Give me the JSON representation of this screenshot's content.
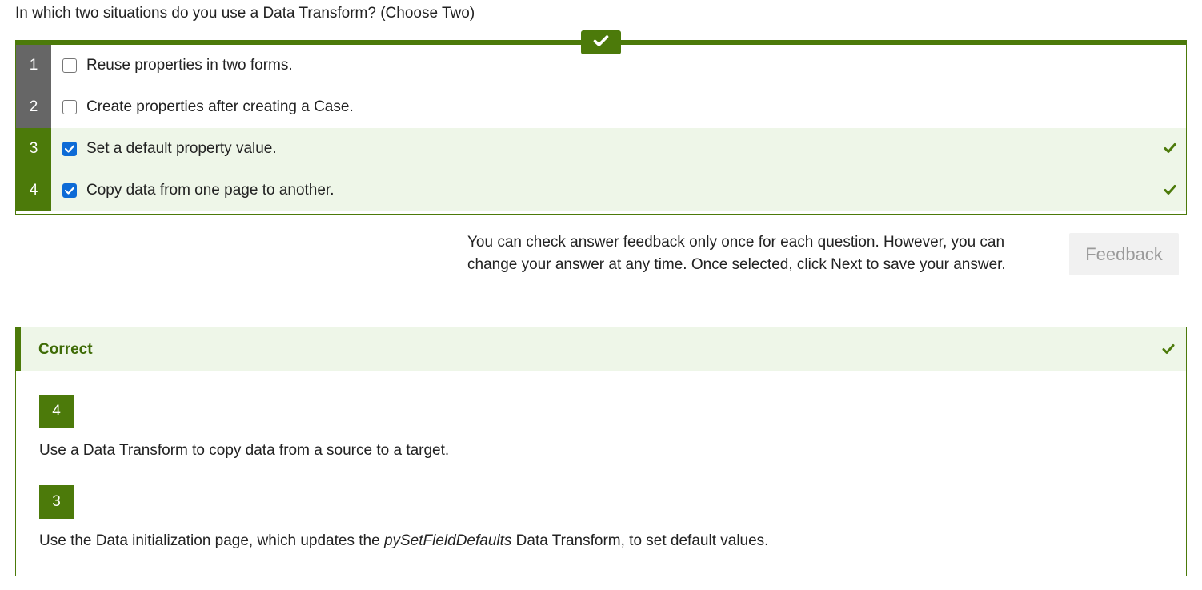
{
  "question": {
    "text": "In which two situations do you use a Data Transform? (Choose Two)"
  },
  "options": [
    {
      "number": "1",
      "label": "Reuse properties in two forms.",
      "checked": false,
      "correct": false
    },
    {
      "number": "2",
      "label": "Create properties after creating a Case.",
      "checked": false,
      "correct": false
    },
    {
      "number": "3",
      "label": "Set a default property value.",
      "checked": true,
      "correct": true
    },
    {
      "number": "4",
      "label": "Copy data from one page to another.",
      "checked": true,
      "correct": true
    }
  ],
  "feedback": {
    "note": "You can check answer feedback only once for each question. However, you can change your answer at any time. Once selected, click Next to save your answer.",
    "button_label": "Feedback"
  },
  "result": {
    "title": "Correct",
    "answers": [
      {
        "number": "4",
        "explanation_before": "Use a Data Transform to copy data from a source to a target.",
        "explanation_em": "",
        "explanation_after": ""
      },
      {
        "number": "3",
        "explanation_before": "Use the Data initialization page, which updates the ",
        "explanation_em": "pySetFieldDefaults",
        "explanation_after": " Data Transform, to set default values."
      }
    ]
  },
  "colors": {
    "accent_green": "#4c7a0a",
    "correct_bg": "#eef6e8",
    "unselected_num_bg": "#666666",
    "checkbox_blue": "#0d6bd6"
  },
  "icons": {
    "top_badge": "check-icon",
    "row_mark": "check-icon",
    "result_mark": "check-icon"
  }
}
